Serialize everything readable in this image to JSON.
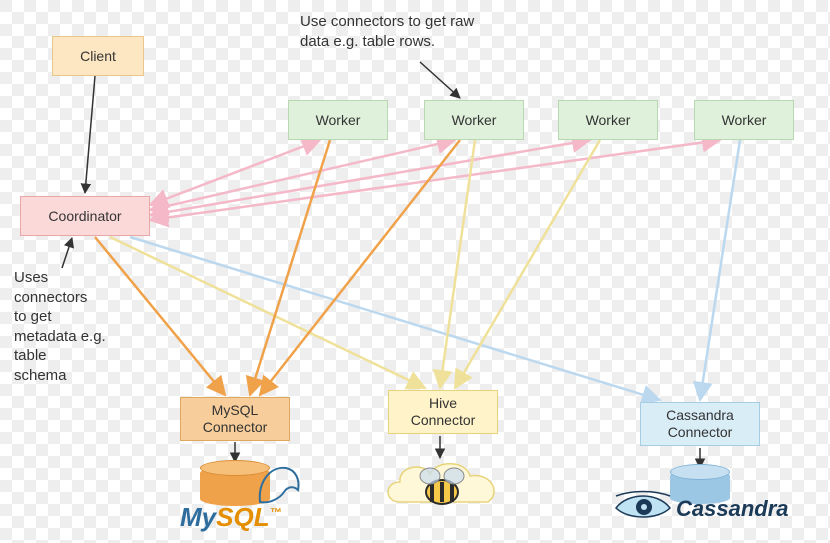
{
  "nodes": {
    "client": "Client",
    "coordinator": "Coordinator",
    "workers": [
      "Worker",
      "Worker",
      "Worker",
      "Worker"
    ],
    "mysql_connector": "MySQL\nConnector",
    "hive_connector": "Hive\nConnector",
    "cassandra_connector": "Cassandra\nConnector"
  },
  "annotations": {
    "worker_note": "Use connectors to get raw\ndata e.g. table rows.",
    "coordinator_note": "Uses\nconnectors\nto get\nmetadata e.g.\ntable\nschema"
  },
  "logos": {
    "mysql": "MySQL",
    "cassandra": "Cassandra"
  },
  "colors": {
    "pink_arrow": "#f4b8c9",
    "orange_arrow": "#f0a24a",
    "yellow_arrow": "#efe19a",
    "blue_arrow": "#bcd8ef",
    "black_arrow": "#333333",
    "mysql_logo_blue": "#2e6e9e",
    "mysql_logo_orange": "#e48e00",
    "cassandra_logo": "#1b3a57",
    "hive_yellow": "#f7c948",
    "hive_black": "#2b2b2b"
  },
  "edges": [
    {
      "from": "client",
      "to": "coordinator",
      "color": "black_arrow"
    },
    {
      "from": "note_coord",
      "to": "coordinator",
      "color": "black_arrow"
    },
    {
      "from": "note_worker",
      "to": "worker_2",
      "color": "black_arrow"
    },
    {
      "from": "coordinator",
      "to": "worker_1",
      "color": "pink_arrow",
      "bidir": true
    },
    {
      "from": "coordinator",
      "to": "worker_2",
      "color": "pink_arrow",
      "bidir": true
    },
    {
      "from": "coordinator",
      "to": "worker_3",
      "color": "pink_arrow",
      "bidir": true
    },
    {
      "from": "coordinator",
      "to": "worker_4",
      "color": "pink_arrow",
      "bidir": true
    },
    {
      "from": "coordinator",
      "to": "mysql_connector",
      "color": "orange_arrow"
    },
    {
      "from": "coordinator",
      "to": "hive_connector",
      "color": "yellow_arrow"
    },
    {
      "from": "coordinator",
      "to": "cassandra_connector",
      "color": "blue_arrow"
    },
    {
      "from": "worker_1",
      "to": "mysql_connector",
      "color": "orange_arrow"
    },
    {
      "from": "worker_2",
      "to": "mysql_connector",
      "color": "orange_arrow"
    },
    {
      "from": "worker_2",
      "to": "hive_connector",
      "color": "yellow_arrow"
    },
    {
      "from": "worker_3",
      "to": "hive_connector",
      "color": "yellow_arrow"
    },
    {
      "from": "worker_4",
      "to": "cassandra_connector",
      "color": "blue_arrow"
    },
    {
      "from": "mysql_connector",
      "to": "mysql_db",
      "color": "black_arrow"
    },
    {
      "from": "hive_connector",
      "to": "hive_db",
      "color": "black_arrow"
    },
    {
      "from": "cassandra_connector",
      "to": "cassandra_db",
      "color": "black_arrow"
    }
  ]
}
